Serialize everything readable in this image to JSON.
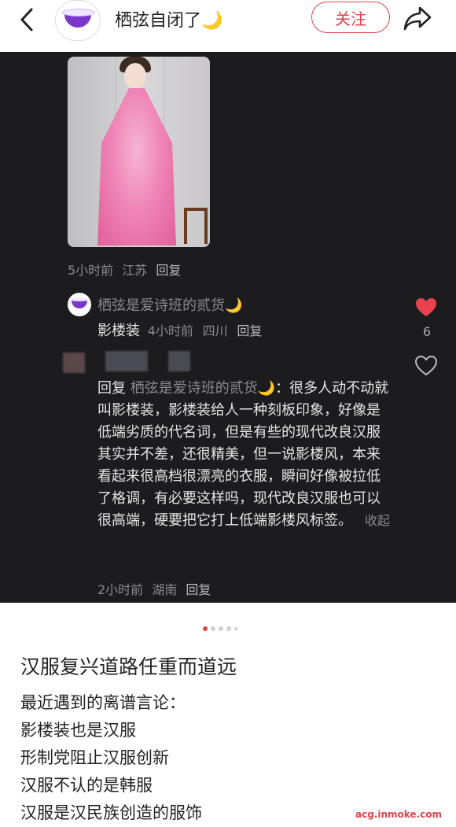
{
  "header": {
    "title": "栖弦自闭了🌙",
    "follow_label": "关注"
  },
  "comment": {
    "meta_time": "5小时前",
    "meta_location": "江苏",
    "meta_reply": "回复"
  },
  "reply1": {
    "name": "栖弦是爱诗班的贰货🌙",
    "text": "影楼装",
    "time": "4小时前",
    "location": "四川",
    "reply": "回复"
  },
  "likes": {
    "count": "6"
  },
  "reply2": {
    "prefix": "回复",
    "target": "栖弦是爱诗班的贰货🌙",
    "text": "：很多人动不动就叫影楼装，影楼装给人一种刻板印象，好像是低端劣质的代名词，但是有些的现代改良汉服其实并不差，还很精美，但一说影楼风，本来看起来很高档很漂亮的衣服，瞬间好像被拉低了格调，有必要这样吗，现代改良汉服也可以很高端，硬要把它打上低端影楼风标签。",
    "fold": "收起",
    "time": "2小时前",
    "location": "湖南",
    "reply": "回复"
  },
  "post": {
    "title": "汉服复兴道路任重而道远",
    "lines": [
      "最近遇到的离谱言论：",
      "影楼装也是汉服",
      "形制党阻止汉服创新",
      "汉服不认的是韩服",
      "汉服是汉民族创造的服饰"
    ]
  },
  "watermark": "acg.inmoke.com",
  "colors": {
    "accent": "#e1424c",
    "dark_bg": "#1c1c1e"
  },
  "icons": [
    "back-icon",
    "share-icon",
    "heart-filled-icon",
    "heart-outline-icon",
    "bowl-avatar-icon"
  ]
}
